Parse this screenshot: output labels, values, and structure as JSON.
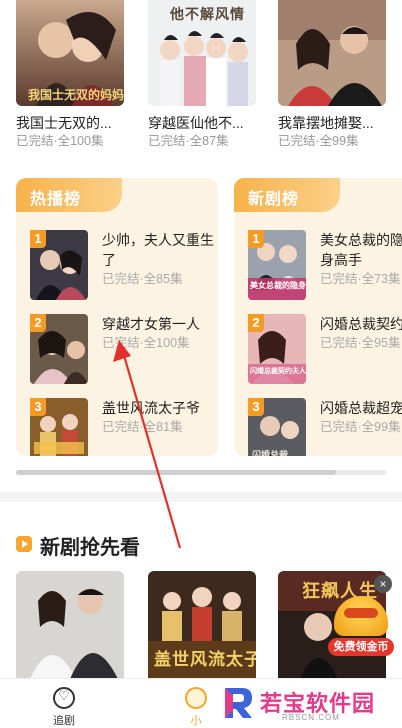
{
  "top_row": [
    {
      "title": "我国士无双的...",
      "meta": "已完结·全100集",
      "poster_text": "我国士无双的妈妈"
    },
    {
      "title": "穿越医仙他不...",
      "meta": "已完结·全87集",
      "poster_text": "他不解风情"
    },
    {
      "title": "我靠摆地摊娶...",
      "meta": "已完结·全99集",
      "poster_text": ""
    }
  ],
  "hot_rank": {
    "tab_label": "热播榜",
    "items": [
      {
        "rank": "1",
        "name": "少帅，夫人又重生了",
        "meta": "已完结·全85集"
      },
      {
        "rank": "2",
        "name": "穿越才女第一人",
        "meta": "已完结·全100集"
      },
      {
        "rank": "3",
        "name": "盖世风流太子爷",
        "meta": "已完结·全81集"
      }
    ]
  },
  "new_rank": {
    "tab_label": "新剧榜",
    "items": [
      {
        "rank": "1",
        "name": "美女总裁的隐身高手",
        "meta": "已完结·全73集",
        "poster_text": "美女总裁的隐身高手"
      },
      {
        "rank": "2",
        "name": "闪婚总裁契约",
        "meta": "已完结·全95集",
        "poster_text": "闪婚总裁契约夫人"
      },
      {
        "rank": "3",
        "name": "闪婚总裁超宠",
        "meta": "已完结·全99集",
        "poster_text": "闪婚总裁"
      }
    ]
  },
  "new_section": {
    "title": "新剧抢先看",
    "cards": [
      {
        "poster_text": ""
      },
      {
        "poster_text": "盖世风流太子爷"
      },
      {
        "poster_text": "狂飙人生"
      }
    ]
  },
  "reward": {
    "label": "免费领金币",
    "close": "×"
  },
  "nav": {
    "tab1": "追剧",
    "tab2": "小"
  },
  "watermark": {
    "main": "若宝软件园",
    "sub": "RBSCN.COM"
  },
  "colors": {
    "accent": "#f5a623",
    "rank_bg": "#fdf3e2",
    "badge": "#f39b25",
    "arrow": "#e0322a"
  }
}
